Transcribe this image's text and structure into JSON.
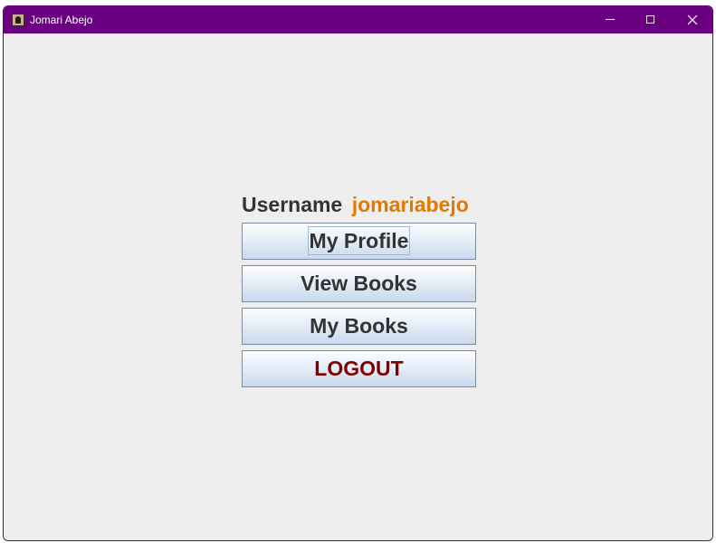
{
  "window": {
    "title": "Jomari Abejo",
    "icon": "app-icon"
  },
  "user": {
    "label": "Username",
    "value": "jomariabejo"
  },
  "menu": {
    "my_profile": "My Profile",
    "view_books": "View Books",
    "my_books": "My Books",
    "logout": "LOGOUT"
  },
  "colors": {
    "titlebar": "#6a0080",
    "username_value": "#e07a00",
    "logout_text": "#800000",
    "background": "#eeeeee"
  }
}
